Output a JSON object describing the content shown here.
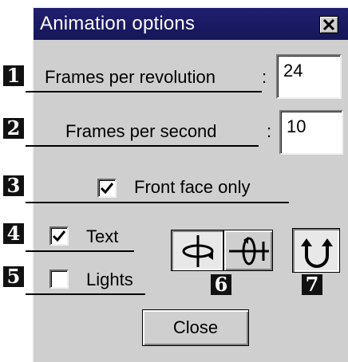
{
  "dialog": {
    "title": "Animation options",
    "close_glyph": "×"
  },
  "callouts": [
    "1",
    "2",
    "3",
    "4",
    "5",
    "6",
    "7"
  ],
  "fields": {
    "frames_per_revolution": {
      "label": "Frames per revolution",
      "colon": ":",
      "value": "24"
    },
    "frames_per_second": {
      "label": "Frames per second",
      "colon": ":",
      "value": "10"
    }
  },
  "checkboxes": {
    "front_face_only": {
      "label": "Front face only",
      "checked": true
    },
    "text": {
      "label": "Text",
      "checked": true
    },
    "lights": {
      "label": "Lights",
      "checked": false
    }
  },
  "rotation_buttons": [
    {
      "icon": "rotate-vertical-axis-icon",
      "pressed": true
    },
    {
      "icon": "rotate-horizontal-axis-icon",
      "pressed": false
    },
    {
      "icon": "loop-rotation-icon",
      "pressed": true
    }
  ],
  "actions": {
    "close_label": "Close"
  }
}
